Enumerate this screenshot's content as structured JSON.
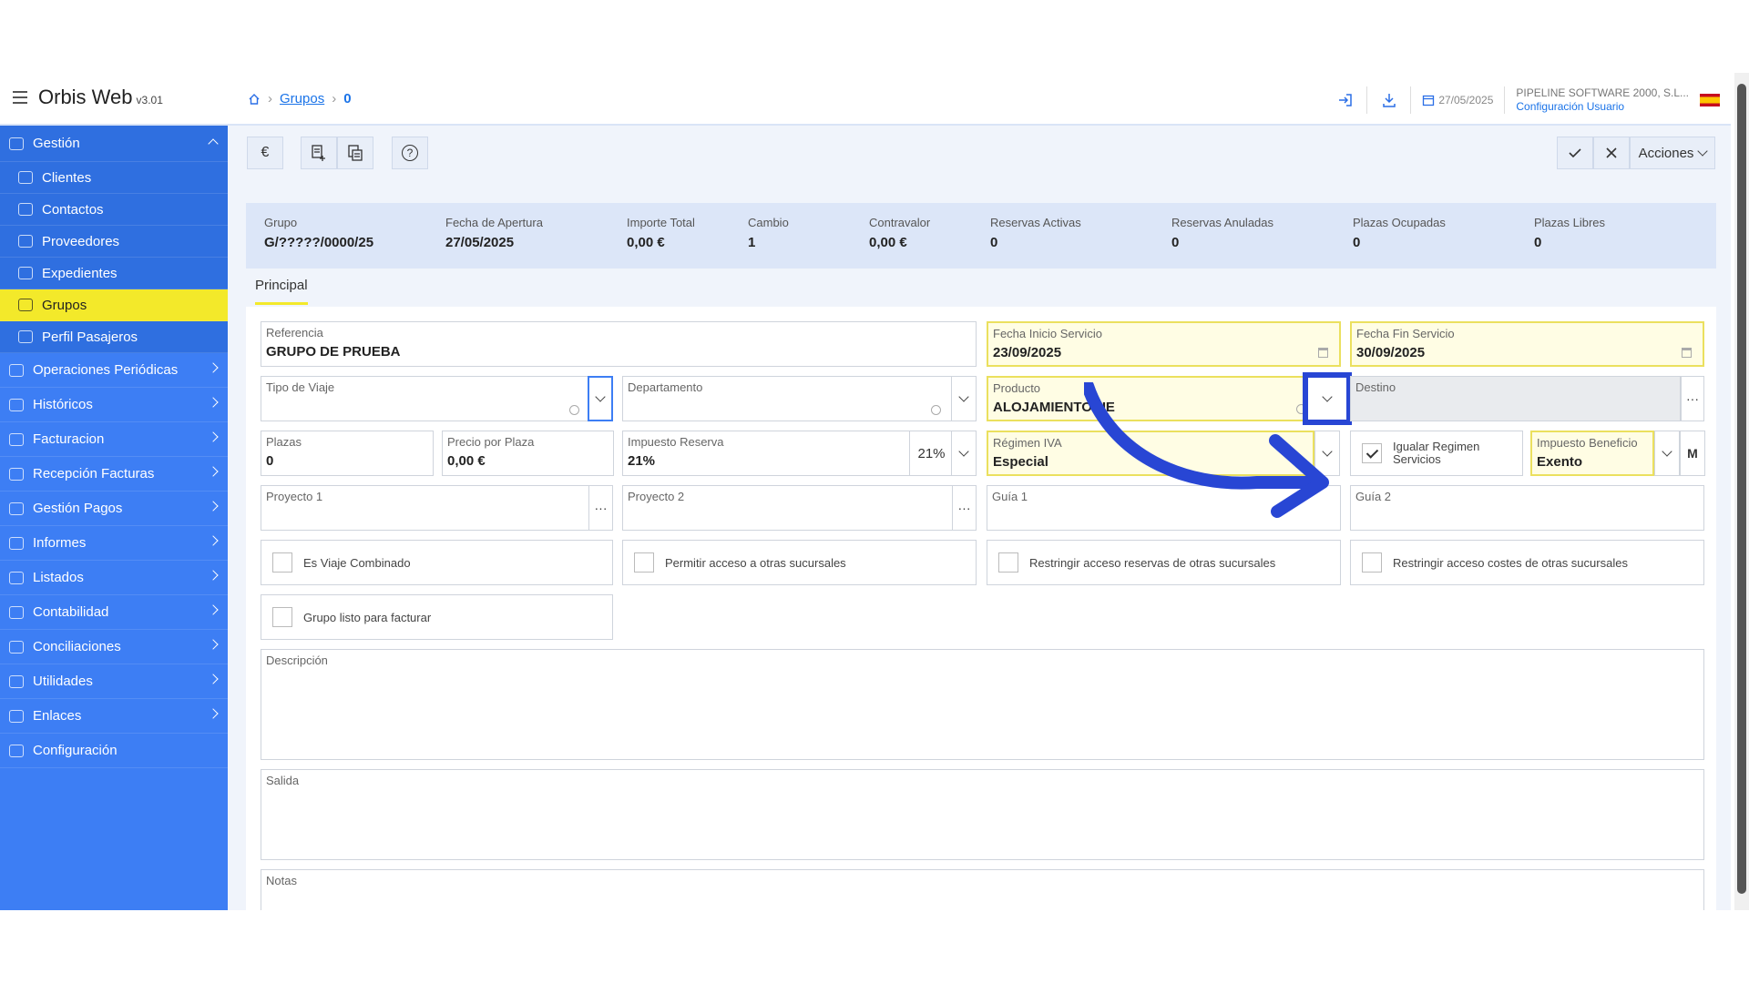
{
  "app": {
    "title": "Orbis Web",
    "version": "v3.01"
  },
  "breadcrumb": {
    "link": "Grupos",
    "current": "0"
  },
  "topbar": {
    "date": "27/05/2025",
    "company": "PIPELINE SOFTWARE 2000, S.L...",
    "config": "Configuración Usuario"
  },
  "sidebar": {
    "header": "Gestión",
    "subitems": [
      "Clientes",
      "Contactos",
      "Proveedores",
      "Expedientes",
      "Grupos",
      "Perfil Pasajeros"
    ],
    "items": [
      "Operaciones Periódicas",
      "Históricos",
      "Facturacion",
      "Recepción Facturas",
      "Gestión Pagos",
      "Informes",
      "Listados",
      "Contabilidad",
      "Conciliaciones",
      "Utilidades",
      "Enlaces",
      "Configuración"
    ]
  },
  "toolbar": {
    "currency": "€",
    "help": "?",
    "acciones": "Acciones"
  },
  "summary": [
    {
      "label": "Grupo",
      "value": "G/?????/0000/25"
    },
    {
      "label": "Fecha de Apertura",
      "value": "27/05/2025"
    },
    {
      "label": "Importe Total",
      "value": "0,00 €"
    },
    {
      "label": "Cambio",
      "value": "1"
    },
    {
      "label": "Contravalor",
      "value": "0,00 €"
    },
    {
      "label": "Reservas Activas",
      "value": "0"
    },
    {
      "label": "Reservas Anuladas",
      "value": "0"
    },
    {
      "label": "Plazas Ocupadas",
      "value": "0"
    },
    {
      "label": "Plazas Libres",
      "value": "0"
    }
  ],
  "tab": "Principal",
  "form": {
    "referencia": {
      "label": "Referencia",
      "value": "GRUPO DE PRUEBA"
    },
    "fecha_inicio": {
      "label": "Fecha Inicio Servicio",
      "value": "23/09/2025"
    },
    "fecha_fin": {
      "label": "Fecha Fin Servicio",
      "value": "30/09/2025"
    },
    "tipo_viaje": {
      "label": "Tipo de Viaje",
      "value": ""
    },
    "departamento": {
      "label": "Departamento",
      "value": ""
    },
    "producto": {
      "label": "Producto",
      "value": "ALOJAMIENTO UE"
    },
    "destino": {
      "label": "Destino",
      "value": ""
    },
    "plazas": {
      "label": "Plazas",
      "value": "0"
    },
    "precio_plaza": {
      "label": "Precio por Plaza",
      "value": "0,00 €"
    },
    "impuesto_reserva": {
      "label": "Impuesto Reserva",
      "value": "21%",
      "pct": "21%"
    },
    "regimen_iva": {
      "label": "Régimen IVA",
      "value": "Especial"
    },
    "igualar": {
      "label": "Igualar Regimen Servicios"
    },
    "impuesto_beneficio": {
      "label": "Impuesto Beneficio",
      "value": "Exento",
      "mark": "M"
    },
    "proyecto1": {
      "label": "Proyecto 1"
    },
    "proyecto2": {
      "label": "Proyecto 2"
    },
    "guia1": {
      "label": "Guía 1"
    },
    "guia2": {
      "label": "Guía 2"
    },
    "checks": [
      "Es Viaje Combinado",
      "Permitir acceso a otras sucursales",
      "Restringir acceso reservas de otras sucursales",
      "Restringir acceso costes de otras sucursales"
    ],
    "grupo_listo": "Grupo listo para facturar",
    "descripcion": "Descripción",
    "salida": "Salida",
    "notas": "Notas"
  },
  "colors": {
    "sidebar": "#3d7ef4",
    "active": "#f3e92a",
    "annotation": "#2846d4"
  }
}
